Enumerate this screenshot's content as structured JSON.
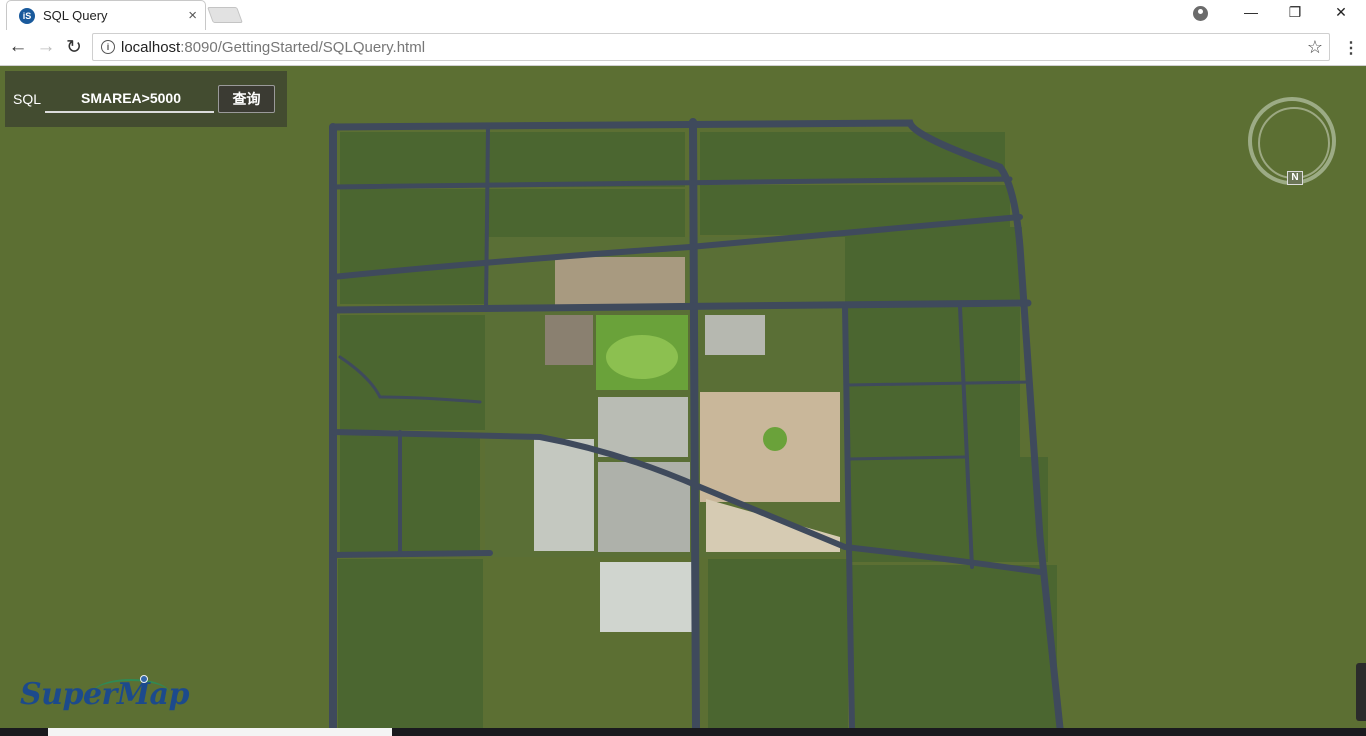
{
  "browser": {
    "tab_title": "SQL Query",
    "tab_favicon": "iS",
    "tab_close": "×",
    "url_host": "localhost",
    "url_rest": ":8090/GettingStarted/SQLQuery.html",
    "back_glyph": "←",
    "forward_glyph": "→",
    "reload_glyph": "↻",
    "star_glyph": "☆",
    "menu_glyph": "⋮",
    "minimize_glyph": "—",
    "restore_glyph": "❐",
    "close_glyph": "✕",
    "info_glyph": "i"
  },
  "query_panel": {
    "label": "SQL",
    "input_value": "SMAREA>5000",
    "button_label": "查询"
  },
  "compass": {
    "north_label": "N"
  },
  "logo": {
    "text": "SuperMap"
  },
  "colors": {
    "grass": "#5c6f33",
    "field": "#4a6530",
    "road": "#3f4a5c",
    "urban_light": "#cfd3cc",
    "park": "#6aa23a"
  },
  "icons": [
    "favicon-icon",
    "close-icon",
    "back-icon",
    "forward-icon",
    "reload-icon",
    "info-icon",
    "star-icon",
    "menu-icon",
    "profile-icon",
    "compass-icon",
    "globe-icon"
  ]
}
